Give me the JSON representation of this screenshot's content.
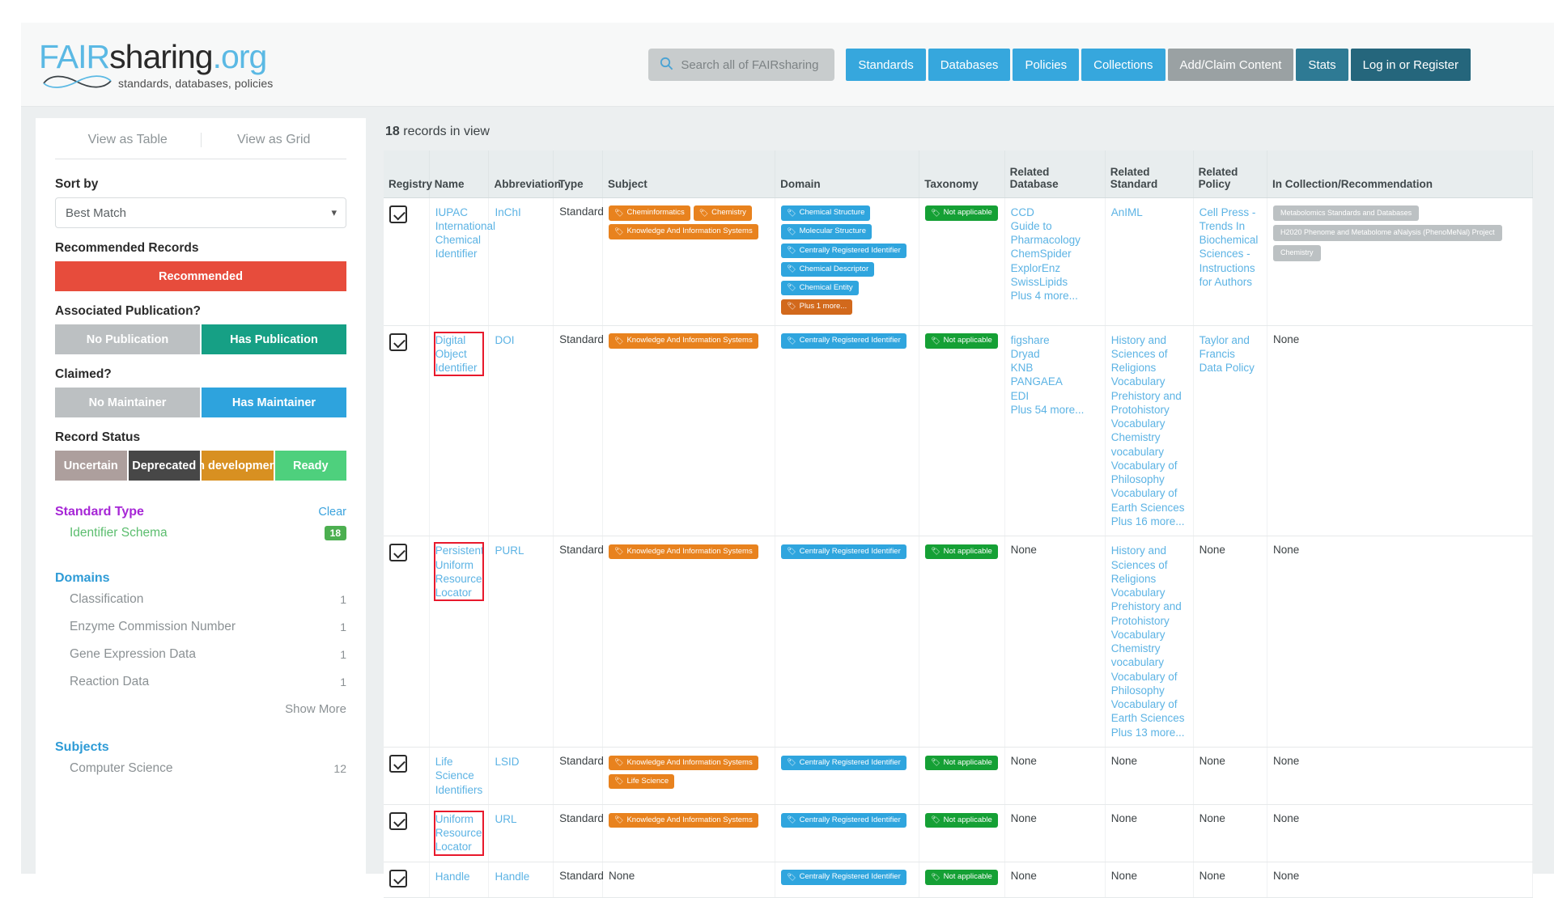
{
  "header": {
    "logo": {
      "fair": "FAIR",
      "sharing": "sharing",
      "org": ".org",
      "tagline": "standards, databases, policies"
    },
    "search": {
      "placeholder": "Search all of FAIRsharing",
      "icon": "search-icon",
      "value": ""
    },
    "nav": [
      {
        "label": "Standards",
        "style": "blue"
      },
      {
        "label": "Databases",
        "style": "blue"
      },
      {
        "label": "Policies",
        "style": "blue"
      },
      {
        "label": "Collections",
        "style": "blue"
      },
      {
        "label": "Add/Claim Content",
        "style": "grey"
      },
      {
        "label": "Stats",
        "style": "teal"
      },
      {
        "label": "Log in or Register",
        "style": "dark"
      }
    ]
  },
  "sidebar": {
    "view_tabs": [
      {
        "label": "View as Table"
      },
      {
        "label": "View as Grid"
      }
    ],
    "sort": {
      "label": "Sort by",
      "value": "Best Match",
      "caret": "chevron-down-icon"
    },
    "recommended": {
      "label": "Recommended Records",
      "button": "Recommended"
    },
    "publication": {
      "label": "Associated Publication?",
      "options": [
        {
          "label": "No Publication",
          "style": "grey"
        },
        {
          "label": "Has Publication",
          "style": "green"
        }
      ]
    },
    "claimed": {
      "label": "Claimed?",
      "options": [
        {
          "label": "No Maintainer",
          "style": "grey"
        },
        {
          "label": "Has Maintainer",
          "style": "blue"
        }
      ]
    },
    "record_status": {
      "label": "Record Status",
      "options": [
        {
          "label": "Uncertain",
          "style": "mauve"
        },
        {
          "label": "Deprecated",
          "style": "dark"
        },
        {
          "label": "In development",
          "style": "orange"
        },
        {
          "label": "Ready",
          "style": "lgreen"
        }
      ]
    },
    "standard_type": {
      "title": "Standard Type",
      "clear": "Clear",
      "items": [
        {
          "label": "Identifier Schema",
          "count": "18"
        }
      ]
    },
    "domains": {
      "title": "Domains",
      "items": [
        {
          "label": "Classification",
          "count": "1"
        },
        {
          "label": "Enzyme Commission Number",
          "count": "1"
        },
        {
          "label": "Gene Expression Data",
          "count": "1"
        },
        {
          "label": "Reaction Data",
          "count": "1"
        }
      ],
      "show_more": "Show More"
    },
    "subjects": {
      "title": "Subjects",
      "items": [
        {
          "label": "Computer Science",
          "count": "12"
        }
      ]
    }
  },
  "results": {
    "count": "18",
    "count_suffix": " records in view",
    "columns": [
      "Registry",
      "Name",
      "Abbreviation",
      "Type",
      "Subject",
      "Domain",
      "Taxonomy",
      "Related Database",
      "Related Standard",
      "Related Policy",
      "In Collection/Recommendation"
    ],
    "rows": [
      {
        "registry_icon": "registry-checkbox-icon",
        "name": "IUPAC International Chemical Identifier",
        "name_highlight": false,
        "abbreviation": "InChI",
        "type": "Standard",
        "subject_tags": [
          {
            "label": "Cheminformatics",
            "style": "orange"
          },
          {
            "label": "Chemistry",
            "style": "orange"
          },
          {
            "label": "Knowledge And Information Systems",
            "style": "orange"
          }
        ],
        "domain_tags": [
          {
            "label": "Chemical Structure",
            "style": "blue"
          },
          {
            "label": "Molecular Structure",
            "style": "blue"
          },
          {
            "label": "Centrally Registered Identifier",
            "style": "blue"
          },
          {
            "label": "Chemical Descriptor",
            "style": "blue"
          },
          {
            "label": "Chemical Entity",
            "style": "blue"
          },
          {
            "label": "Plus 1 more...",
            "style": "darkorange"
          }
        ],
        "taxonomy_tags": [
          {
            "label": "Not applicable",
            "style": "green"
          }
        ],
        "related_database": [
          "CCD",
          "Guide to Pharmacology",
          "ChemSpider",
          "ExplorEnz",
          "SwissLipids",
          "Plus 4 more..."
        ],
        "related_standard": [
          "AnIML"
        ],
        "related_policy": [
          "Cell Press - Trends In Biochemical Sciences - Instructions for Authors"
        ],
        "collections": [
          "Metabolomics Standards and Databases",
          "H2020 Phenome and Metabolome aNalysis (PhenoMeNal) Project",
          "Chemistry"
        ]
      },
      {
        "registry_icon": "registry-checkbox-icon",
        "name": "Digital Object Identifier",
        "name_highlight": true,
        "abbreviation": "DOI",
        "type": "Standard",
        "subject_tags": [
          {
            "label": "Knowledge And Information Systems",
            "style": "orange"
          }
        ],
        "domain_tags": [
          {
            "label": "Centrally Registered Identifier",
            "style": "blue"
          }
        ],
        "taxonomy_tags": [
          {
            "label": "Not applicable",
            "style": "green"
          }
        ],
        "related_database": [
          "figshare",
          "Dryad",
          "KNB",
          "PANGAEA",
          "EDI",
          "Plus 54 more..."
        ],
        "related_standard": [
          "History and Sciences of Religions Vocabulary",
          "Prehistory and Protohistory Vocabulary",
          "Chemistry vocabulary",
          "Vocabulary of Philosophy",
          "Vocabulary of Earth Sciences",
          "Plus 16 more..."
        ],
        "related_policy": [
          "Taylor and Francis Data Policy"
        ],
        "collections_none": "None",
        "collections": []
      },
      {
        "registry_icon": "registry-checkbox-icon",
        "name": "Persistent Uniform Resource Locator",
        "name_highlight": true,
        "abbreviation": "PURL",
        "type": "Standard",
        "subject_tags": [
          {
            "label": "Knowledge And Information Systems",
            "style": "orange"
          }
        ],
        "domain_tags": [
          {
            "label": "Centrally Registered Identifier",
            "style": "blue"
          }
        ],
        "taxonomy_tags": [
          {
            "label": "Not applicable",
            "style": "green"
          }
        ],
        "related_database_none": "None",
        "related_database": [],
        "related_standard": [
          "History and Sciences of Religions Vocabulary",
          "Prehistory and Protohistory Vocabulary",
          "Chemistry vocabulary",
          "Vocabulary of Philosophy",
          "Vocabulary of Earth Sciences",
          "Plus 13 more..."
        ],
        "related_policy_none": "None",
        "related_policy": [],
        "collections_none": "None",
        "collections": []
      },
      {
        "registry_icon": "registry-checkbox-icon",
        "name": "Life Science Identifiers",
        "name_highlight": false,
        "abbreviation": "LSID",
        "type": "Standard",
        "subject_tags": [
          {
            "label": "Knowledge And Information Systems",
            "style": "orange"
          },
          {
            "label": "Life Science",
            "style": "orange"
          }
        ],
        "domain_tags": [
          {
            "label": "Centrally Registered Identifier",
            "style": "blue"
          }
        ],
        "taxonomy_tags": [
          {
            "label": "Not applicable",
            "style": "green"
          }
        ],
        "related_database_none": "None",
        "related_database": [],
        "related_standard_none": "None",
        "related_standard": [],
        "related_policy_none": "None",
        "related_policy": [],
        "collections_none": "None",
        "collections": []
      },
      {
        "registry_icon": "registry-checkbox-icon",
        "name": "Uniform Resource Locator",
        "name_highlight": true,
        "abbreviation": "URL",
        "type": "Standard",
        "subject_tags": [
          {
            "label": "Knowledge And Information Systems",
            "style": "orange"
          }
        ],
        "domain_tags": [
          {
            "label": "Centrally Registered Identifier",
            "style": "blue"
          }
        ],
        "taxonomy_tags": [
          {
            "label": "Not applicable",
            "style": "green"
          }
        ],
        "related_database_none": "None",
        "related_database": [],
        "related_standard_none": "None",
        "related_standard": [],
        "related_policy_none": "None",
        "related_policy": [],
        "collections_none": "None",
        "collections": []
      },
      {
        "registry_icon": "registry-checkbox-icon",
        "name": "Handle",
        "name_highlight": false,
        "abbreviation": "Handle",
        "type": "Standard",
        "subject_none": "None",
        "subject_tags": [],
        "domain_tags": [
          {
            "label": "Centrally Registered Identifier",
            "style": "blue"
          }
        ],
        "taxonomy_tags": [
          {
            "label": "Not applicable",
            "style": "green"
          }
        ],
        "related_database_none": "None",
        "related_database": [],
        "related_standard_none": "None",
        "related_standard": [],
        "related_policy_none": "None",
        "related_policy": [],
        "collections_none": "None",
        "collections": []
      }
    ]
  },
  "colors": {
    "accent_blue": "#36a7dd",
    "link_blue": "#5cb3e4",
    "tag_orange": "#e8821e",
    "tag_blue": "#2fa5de",
    "tag_green": "#15a035",
    "recommended_red": "#e74c3c",
    "highlight_red": "#e8192c"
  }
}
